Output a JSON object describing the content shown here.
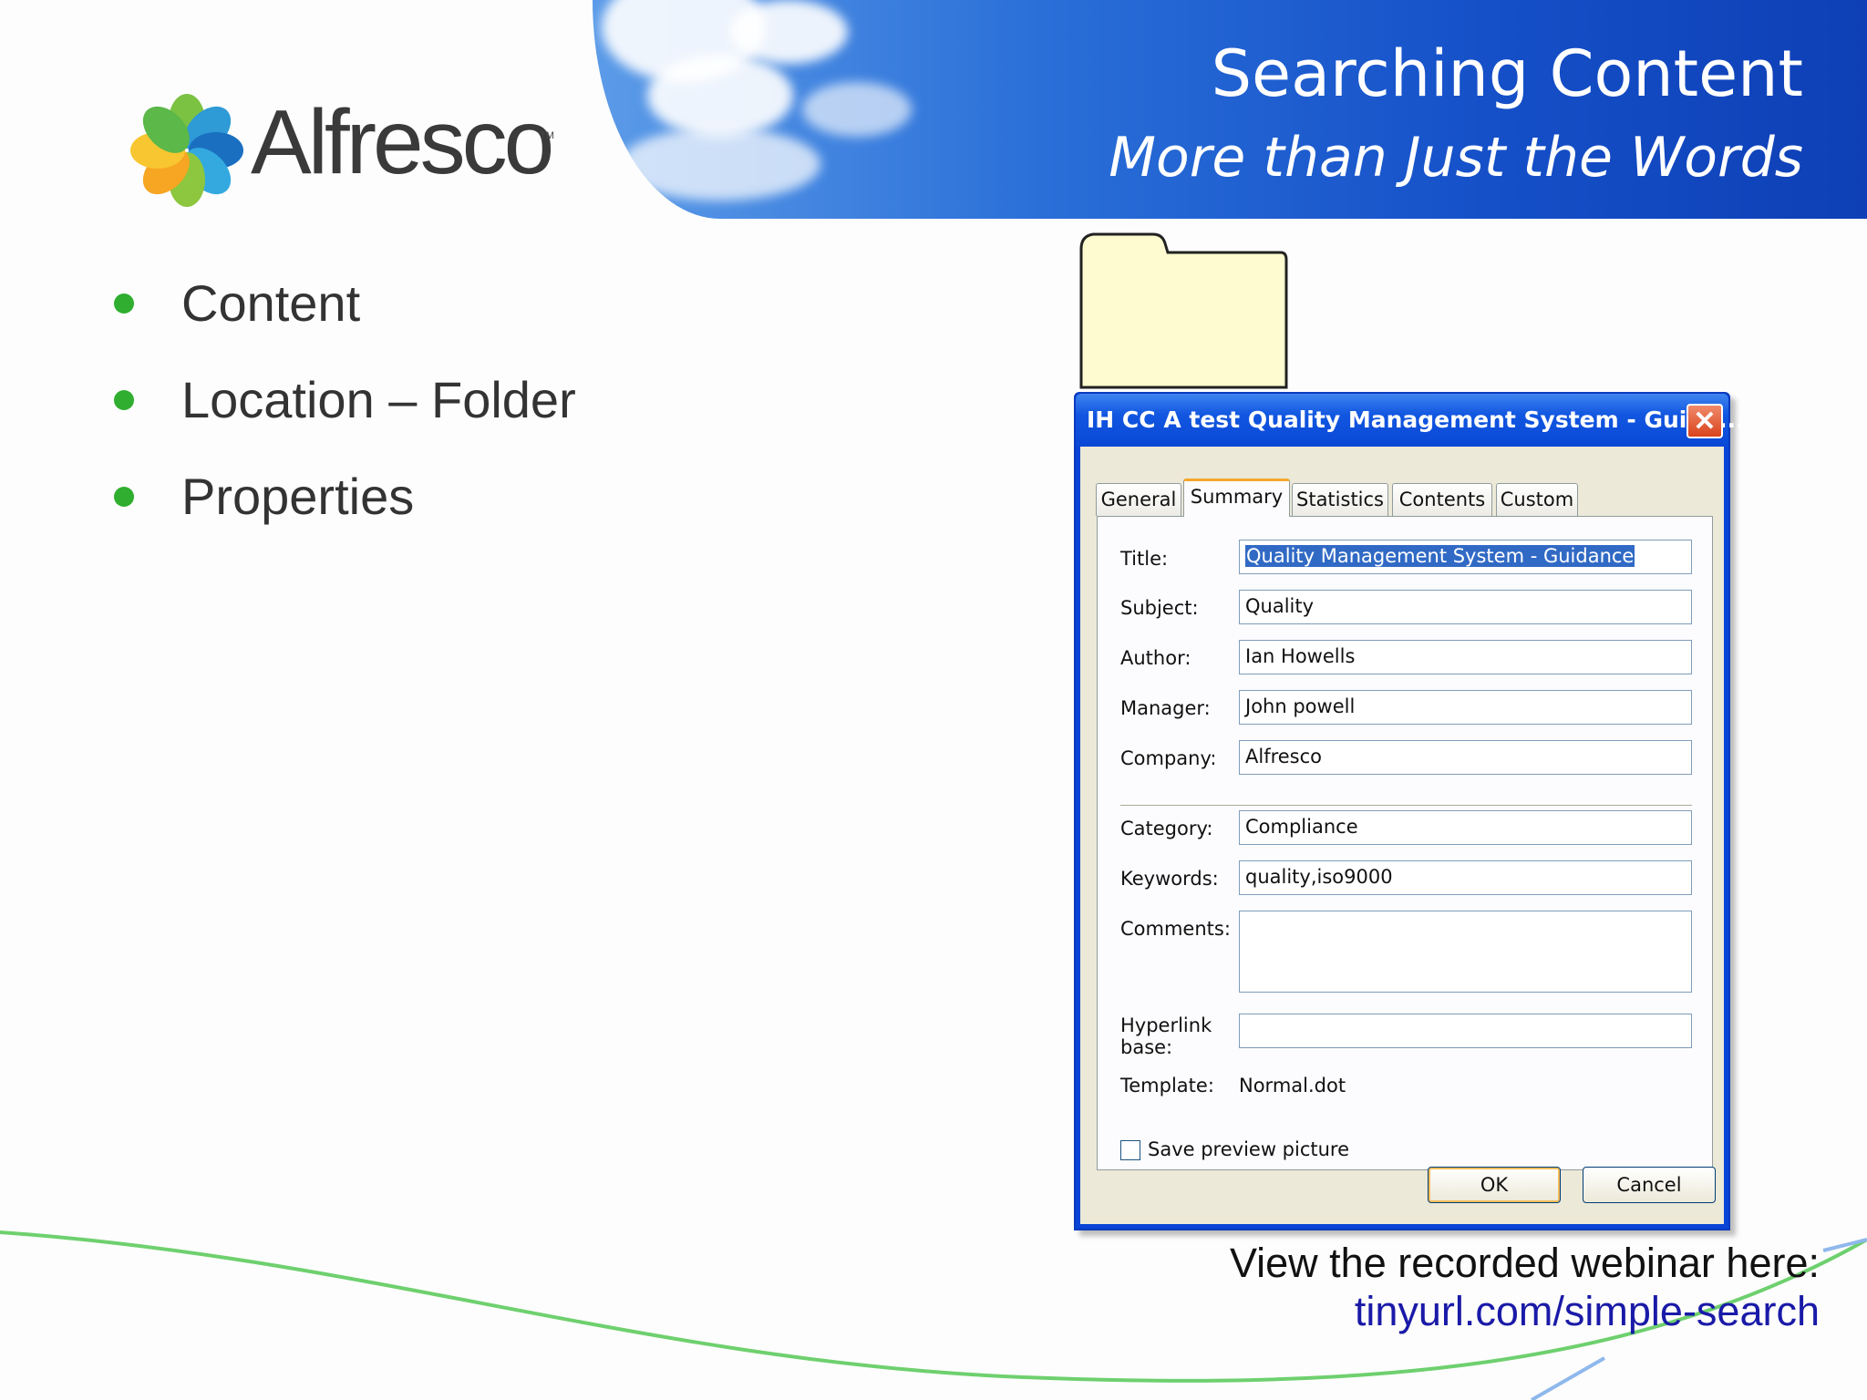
{
  "header": {
    "title": "Searching Content",
    "subtitle": "More than Just the Words"
  },
  "logo": {
    "word": "Alfresco",
    "tm": "TM"
  },
  "bullets": [
    {
      "text": "Content"
    },
    {
      "text": "Location – Folder"
    },
    {
      "text": "Properties"
    }
  ],
  "dialog": {
    "title": "IH CC A test Quality Management System - Guida...",
    "close_glyph": "✕",
    "tabs": [
      "General",
      "Summary",
      "Statistics",
      "Contents",
      "Custom"
    ],
    "active_tab": "Summary",
    "fields": {
      "title_label": "Title:",
      "title_value": "Quality Management System - Guidance",
      "subject_label": "Subject:",
      "subject_value": "Quality",
      "author_label": "Author:",
      "author_value": "Ian Howells",
      "manager_label": "Manager:",
      "manager_value": "John powell",
      "company_label": "Company:",
      "company_value": "Alfresco",
      "category_label": "Category:",
      "category_value": "Compliance",
      "keywords_label": "Keywords:",
      "keywords_value": "quality,iso9000",
      "comments_label": "Comments:",
      "comments_value": "",
      "hyperlink_label_1": "Hyperlink",
      "hyperlink_label_2": "base:",
      "hyperlink_value": "",
      "template_label": "Template:",
      "template_value": "Normal.dot"
    },
    "save_preview_label": "Save preview picture",
    "save_preview_checked": false,
    "ok_label": "OK",
    "cancel_label": "Cancel"
  },
  "footer": {
    "webinar_text": "View the recorded webinar here:",
    "link_text": "tinyurl.com/simple-search"
  },
  "colors": {
    "bullet": "#2fae2f",
    "banner": "#1550c8",
    "dialog_frame": "#0a44d6",
    "link": "#1a1aa8"
  }
}
